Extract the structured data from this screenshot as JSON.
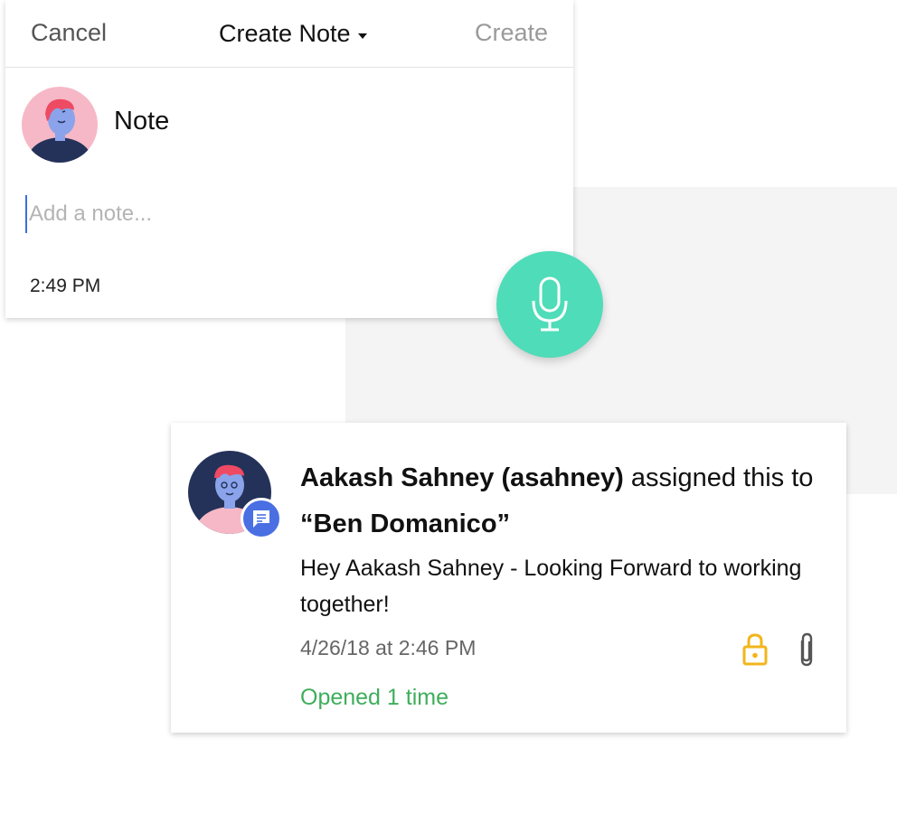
{
  "note_composer": {
    "cancel_label": "Cancel",
    "title": "Create Note",
    "create_label": "Create",
    "note_type": "Note",
    "input_placeholder": "Add a note...",
    "input_value": "",
    "time": "2:49 PM"
  },
  "mic": {
    "icon": "microphone-icon",
    "color": "#4fdcb8"
  },
  "activity": {
    "actor": "Aakash Sahney (asahney)",
    "action": "assigned this to",
    "target": "“Ben Domanico”",
    "message": "Hey Aakash Sahney - Looking Forward to working together!",
    "datetime": "4/26/18 at 2:46 PM",
    "opened": "Opened 1 time",
    "badge_icon": "comment-icon",
    "lock_icon": "lock-icon",
    "attach_icon": "paperclip-icon"
  },
  "colors": {
    "accent_blue": "#4a6fe3",
    "mic_green": "#4fdcb8",
    "opened_green": "#3fae5b",
    "lock_yellow": "#f2b51c"
  }
}
